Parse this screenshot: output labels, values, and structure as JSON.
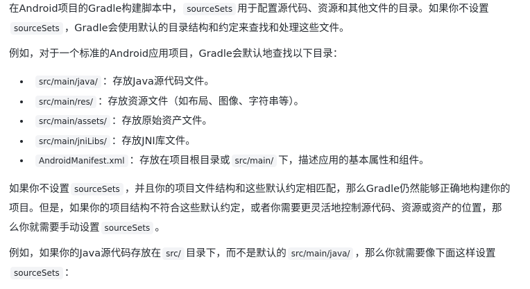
{
  "p1": {
    "l1a": "在Android项目的Gradle构建脚本中，",
    "l1code": "sourceSets",
    "l1b": "用于配置源代码、资源和其他文件的目录。如果你不设置",
    "l2code": "sourceSets",
    "l2b": "，Gradle会使用默认的目录结构和约定来查找和处理这些文件。"
  },
  "p2": {
    "text": "例如，对于一个标准的Android应用项目，Gradle会默认地查找以下目录："
  },
  "list": [
    {
      "code": "src/main/java/",
      "text": "：存放Java源代码文件。"
    },
    {
      "code": "src/main/res/",
      "text": "：存放资源文件（如布局、图像、字符串等）。"
    },
    {
      "code": "src/main/assets/",
      "text": "：存放原始资产文件。"
    },
    {
      "code": "src/main/jniLibs/",
      "text": "：存放JNI库文件。"
    },
    {
      "code": "AndroidManifest.xml",
      "text_a": "：存放在项目根目录或",
      "code2": "src/main/",
      "text_b": "下，描述应用的基本属性和组件。"
    }
  ],
  "p3": {
    "l1a": "如果你不设置",
    "l1code": "sourceSets",
    "l1b": "，并且你的项目文件结构和这些默认约定相匹配，那么Gradle仍然能够正确地构建你的",
    "l2": "项目。但是，如果你的项目结构不符合这些默认约定，或者你需要更灵活地控制源代码、资源或资产的位置，那",
    "l3a": "么你就需要手动设置",
    "l3code": "sourceSets",
    "l3b": "。"
  },
  "p4": {
    "l1a": "例如，如果你的Java源代码存放在",
    "l1code1": "src/",
    "l1b": "目录下，而不是默认的",
    "l1code2": "src/main/java/",
    "l1c": "，那么你就需要像下面这样设置",
    "l2code": "sourceSets",
    "l2b": "："
  }
}
